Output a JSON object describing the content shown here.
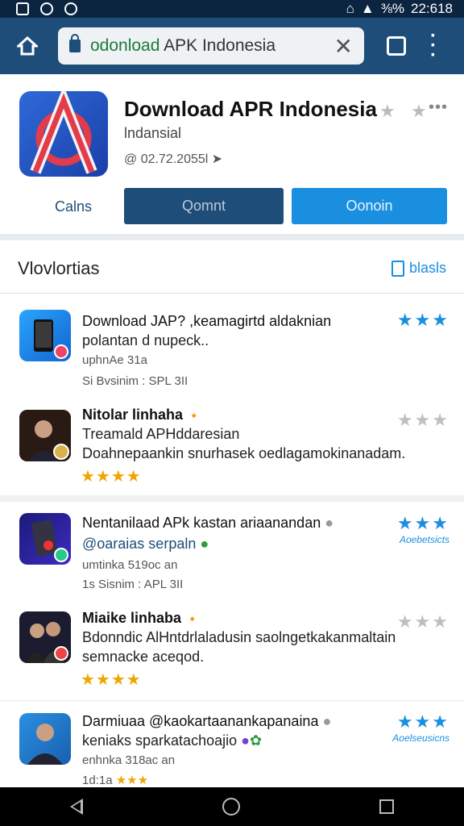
{
  "status_bar": {
    "time": "22:618",
    "battery": "⅜%",
    "left_icons": [
      "image-icon",
      "compass-icon",
      "check-circle-icon"
    ]
  },
  "browser": {
    "url_prefix": "odonload",
    "url_rest": " APK Indonesia",
    "clear_glyph": "✕"
  },
  "app": {
    "title": "Download APR Indonesia",
    "subtitle": "lndansial",
    "meta": "@ 02.72.2055l",
    "cancel_label": "Calns",
    "install_label": "Qomnt",
    "open_label": "Oonoin"
  },
  "section": {
    "title": "Vlovlortias",
    "action_label": "blasls"
  },
  "items": [
    {
      "line1": "Download JAP? ,keamagirtd aldaknian",
      "line2": "polantan d nupeck..",
      "line3": "uphnAe 31a",
      "line4": "Si Bvsinim : SPL 3II",
      "stars": "★★★",
      "stars_style": "blue",
      "badge": ""
    },
    {
      "line1": "Nitolar linhaha",
      "line2": "Treamald APHddaresian",
      "line3": "Doahnepaankin snurhasek oedlagamokinanadam.",
      "line4": "",
      "stars": "★★★",
      "stars_style": "grey",
      "gold": "★★★★",
      "badge": ""
    },
    {
      "line1": "Nentanilaad APk kastan ariaanandan",
      "line2": "@oaraias serpaln",
      "line3": "umtinka 519oc an",
      "line4": "1s Sisnim : APL 3II",
      "stars": "★★★",
      "stars_style": "blue",
      "badge": "Aoebetsicts"
    },
    {
      "line1": "Miaike linhaba",
      "line2": "Bdonndic AlHntdrlaladusin saolngetkakanmaltain",
      "line3": "semnacke aceqod.",
      "line4": "",
      "stars": "★★★",
      "stars_style": "grey",
      "gold": "★★★★",
      "badge": ""
    },
    {
      "line1": "Darmiuaa @kaokartaanankapanaina",
      "line2": "keniaks sparkatachoajio",
      "line3": "enhnka 318ac an",
      "line4": "1d:1a",
      "stars": "★★★",
      "stars_style": "blue",
      "badge": "Aoelseusicns"
    }
  ],
  "nav": {
    "back": "◁",
    "home": "○",
    "recent": "□"
  }
}
